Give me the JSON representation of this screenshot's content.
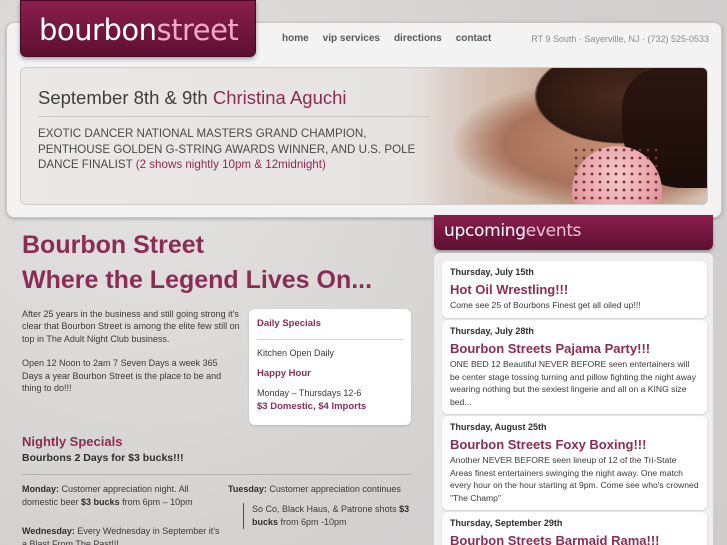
{
  "logo": {
    "part1": "bourbon",
    "part2": "street"
  },
  "nav": {
    "items": [
      "home",
      "vip services",
      "directions",
      "contact"
    ]
  },
  "address": "RT 9 South · Sayerville, NJ · (732) 525-0533",
  "banner": {
    "date_text": "September 8th & 9th",
    "performer": "Christina Aguchi",
    "description": "Exotic Dancer National Masters Grand Champion, Penthouse Golden G-String Awards Winner, and U.S. Pole Dance Finalist",
    "shows": "(2 shows nightly 10pm & 12midnight)"
  },
  "main": {
    "title": "Bourbon Street",
    "subtitle": "Where the Legend Lives On...",
    "intro_1": "After 25 years in the business and still going strong it's clear that Bourbon Street is among the elite few still on top in The Adult Night Club business.",
    "intro_2": "Open 12 Noon to 2am 7 Seven Days a week 365 Days a year Bourbon Street is the place to be and thing to do!!!"
  },
  "daily_specials": {
    "header": "Daily Specials",
    "kitchen": "Kitchen Open Daily",
    "happy_hour": "Happy Hour",
    "hours": "Monday – Thursdays 12-6",
    "prices": "$3 Domestic, $4 Imports"
  },
  "nightly": {
    "title": "Nightly Specials",
    "subtitle": "Bourbons 2 Days for $3 bucks!!!",
    "monday_day": "Monday:",
    "monday_text": "Customer appreciation night. All domestic beer",
    "monday_price": "$3 bucks",
    "monday_time": "from 6pm – 10pm",
    "tuesday_day": "Tuesday:",
    "tuesday_text": "Customer appreciation continues",
    "tuesday_extra_1": "So Co, Black Haus, & Patrone shots",
    "tuesday_price": "$3 bucks",
    "tuesday_time": "from 6pm -10pm",
    "wednesday_day": "Wednesday:",
    "wednesday_text": "Every Wednesday in September it's a Blast From The Past!!!"
  },
  "events": {
    "header_1": "upcoming",
    "header_2": "events",
    "items": [
      {
        "date": "Thursday, July 15th",
        "title": "Hot Oil Wrestling!!!",
        "desc": "Come see 25 of Bourbons Finest get all oiled up!!!"
      },
      {
        "date": "Thursday, July 28th",
        "title": "Bourbon Streets Pajama Party!!!",
        "desc": "ONE BED 12 Beautiful NEVER BEFORE seen entertainers will be center stage tossing turning and pillow fighting the night away wearing nothing but the sexiest lingerie and all on a KING size bed..."
      },
      {
        "date": "Thursday, August 25th",
        "title": "Bourbon Streets Foxy Boxing!!!",
        "desc": "Another NEVER BEFORE seen lineup of 12 of the Tri-State Areas finest entertainers swinging the night away. One match every hour on the hour starting at 9pm. Come see who's crowned \"The Champ\""
      },
      {
        "date": "Thursday, September 29th",
        "title": "Bourbon Streets Barmaid Rama!!!",
        "desc": ""
      }
    ]
  },
  "colors": {
    "brand": "#8c2c55",
    "brand_dark": "#5e0f31",
    "background": "#d9d7d6"
  }
}
